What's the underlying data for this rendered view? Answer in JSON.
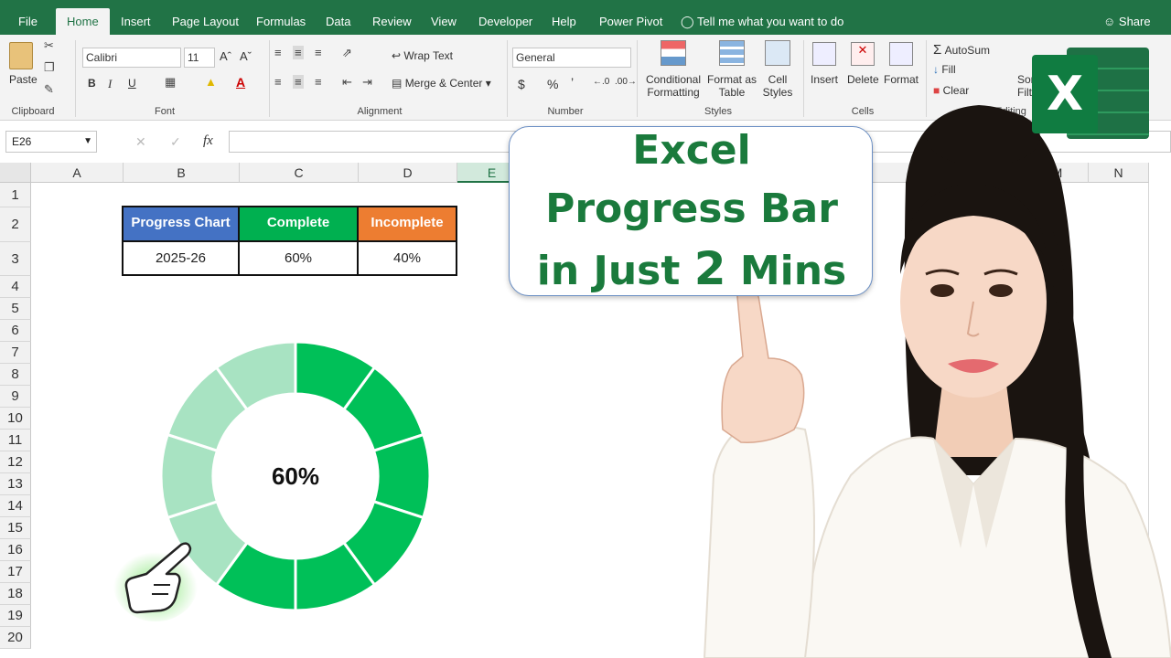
{
  "tabs": [
    "File",
    "Home",
    "Insert",
    "Page Layout",
    "Formulas",
    "Data",
    "Review",
    "View",
    "Developer",
    "Help",
    "Power Pivot"
  ],
  "active_tab": "Home",
  "tell_me": "Tell me what you want to do",
  "share": "Share",
  "ribbon": {
    "clipboard": {
      "paste": "Paste",
      "label": "Clipboard"
    },
    "font": {
      "name": "Calibri",
      "size": "11",
      "bold": "B",
      "italic": "I",
      "underline": "U",
      "label": "Font"
    },
    "alignment": {
      "wrap": "Wrap Text",
      "merge": "Merge & Center",
      "label": "Alignment"
    },
    "number": {
      "format": "General",
      "currency": "$",
      "percent": "%",
      "comma": "’",
      "label": "Number"
    },
    "styles": {
      "conditional_1": "Conditional",
      "conditional_2": "Formatting",
      "format_table_1": "Format as",
      "format_table_2": "Table",
      "cell_styles_1": "Cell",
      "cell_styles_2": "Styles",
      "label": "Styles"
    },
    "cells": {
      "insert": "Insert",
      "delete": "Delete",
      "format": "Format",
      "label": "Cells"
    },
    "editing": {
      "autosum": "AutoSum",
      "fill": "Fill",
      "clear": "Clear",
      "sort_1": "Sor",
      "sort_2": "Filt",
      "label": "Editing"
    }
  },
  "formula_bar": {
    "name_box": "E26",
    "fx": "fx",
    "cancel": "✕",
    "enter": "✓"
  },
  "columns": [
    "A",
    "B",
    "C",
    "D",
    "E",
    "M",
    "N"
  ],
  "selected_column": "E",
  "rows": [
    "1",
    "2",
    "3",
    "4",
    "5",
    "6",
    "7",
    "8",
    "9",
    "10",
    "11",
    "12",
    "13",
    "14",
    "15",
    "16",
    "17",
    "18",
    "19",
    "20"
  ],
  "table": {
    "headers": [
      "Progress Chart",
      "Complete",
      "Incomplete"
    ],
    "header_colors": [
      "#4472c4",
      "#00b050",
      "#ed7d31"
    ],
    "values": [
      "2025-26",
      "60%",
      "40%"
    ]
  },
  "chart_data": {
    "type": "pie",
    "style": "doughnut",
    "segments": 10,
    "values": [
      60,
      40
    ],
    "labels": [
      "Complete",
      "Incomplete"
    ],
    "colors": [
      "#00c058",
      "#a8e3c2"
    ],
    "center_label": "60%"
  },
  "callout": {
    "line1": "Excel",
    "line2": "Progress Bar",
    "line3_pre": "in Just ",
    "line3_num": "2",
    "line3_post": " Mins"
  },
  "colors": {
    "excel_green": "#217346",
    "callout_text": "#1a7a3c"
  },
  "logo_letter": "X"
}
